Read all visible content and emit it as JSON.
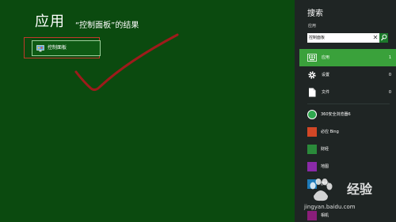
{
  "results": {
    "title": "应用",
    "caption": "“控制面板”的结果",
    "tile_label": "控制面板",
    "tile_icon": "control-panel-icon"
  },
  "search_pane": {
    "title": "搜索",
    "scope": "应用",
    "input_value": "控制面板",
    "clear_glyph": "✕",
    "go_glyph": "⚲",
    "filters": [
      {
        "label": "应用",
        "count": "1",
        "icon": "apps-icon"
      },
      {
        "label": "设置",
        "count": "0",
        "icon": "settings-gear-icon"
      },
      {
        "label": "文件",
        "count": "0",
        "icon": "file-icon"
      }
    ],
    "apps": [
      {
        "label": "360安全浏览器6",
        "icon": "browser-360-icon",
        "color": "#2fa84f"
      },
      {
        "label": "必应 Bing",
        "icon": "bing-icon",
        "color": "#d24726"
      },
      {
        "label": "财经",
        "icon": "finance-icon",
        "color": "#2a8a3a"
      },
      {
        "label": "地图",
        "icon": "maps-icon",
        "color": "#8a2aa8"
      },
      {
        "label": "旅游",
        "icon": "travel-icon",
        "color": "#1e7ab8"
      },
      {
        "label": "相机",
        "icon": "camera-icon",
        "color": "#8a1e7a"
      }
    ]
  },
  "watermark": {
    "brand": "经验",
    "url": "jingyan.baidu.com"
  },
  "colors": {
    "background": "#0b4a0f",
    "pane": "#1f2524",
    "accent": "#3aa13b",
    "annotation": "#c0392b"
  }
}
